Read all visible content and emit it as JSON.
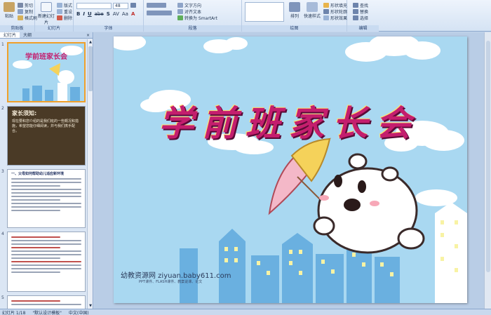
{
  "ribbon": {
    "groups": [
      {
        "label": "剪贴板"
      },
      {
        "label": "幻灯片"
      },
      {
        "label": "字体"
      },
      {
        "label": "段落"
      },
      {
        "label": "绘图"
      },
      {
        "label": "编辑"
      }
    ],
    "clipboard": {
      "paste": "粘贴",
      "cut": "剪切",
      "copy": "复制",
      "format_painter": "格式刷"
    },
    "slides": {
      "new_slide": "新建幻灯片",
      "layout": "版式",
      "reset": "重设",
      "delete": "删除"
    },
    "font": {
      "font_name": "",
      "font_size": "48",
      "bold": "B",
      "italic": "I",
      "underline": "U",
      "strike": "abe",
      "shadow": "S",
      "spacing": "AV",
      "case": "Aa",
      "color": "A"
    },
    "paragraph": {
      "text_direction": "文字方向",
      "align_text": "对齐文本",
      "smartart": "转换为 SmartArt"
    },
    "drawing": {
      "arrange": "排列",
      "quick_styles": "快速样式",
      "shape_fill": "形状填充",
      "shape_outline": "形状轮廓",
      "shape_effects": "形状效果"
    },
    "editing": {
      "find": "查找",
      "replace": "替换",
      "select": "选择"
    }
  },
  "left_panel": {
    "tabs": [
      "幻灯片",
      "大纲"
    ],
    "close": "×",
    "slides": [
      {
        "num": "1"
      },
      {
        "num": "2",
        "heading": "家长须知:",
        "body": "现在要和您介绍的是我们班的一些概况和措施，希望您能仔细阅读，并与我们携手配合。"
      },
      {
        "num": "3",
        "heading": "一、父母如何帮助幼儿适应新环境"
      },
      {
        "num": "4"
      },
      {
        "num": "5"
      }
    ]
  },
  "slide": {
    "title": "学前班家长会",
    "watermark": "幼教资源网 ziyuan.baby611.com",
    "watermark_sub": "PPT课件、FLASH课件、教案说课、论文"
  },
  "status": {
    "slide_pos": "幻灯片 1/18",
    "theme": "\"默认设计模板\"",
    "language": "中文(中国)"
  },
  "colors": {
    "sky": "#a9d8f1",
    "building": "#6ab0e0",
    "title": "#c41e6e",
    "ribbon": "#dce8f6"
  }
}
